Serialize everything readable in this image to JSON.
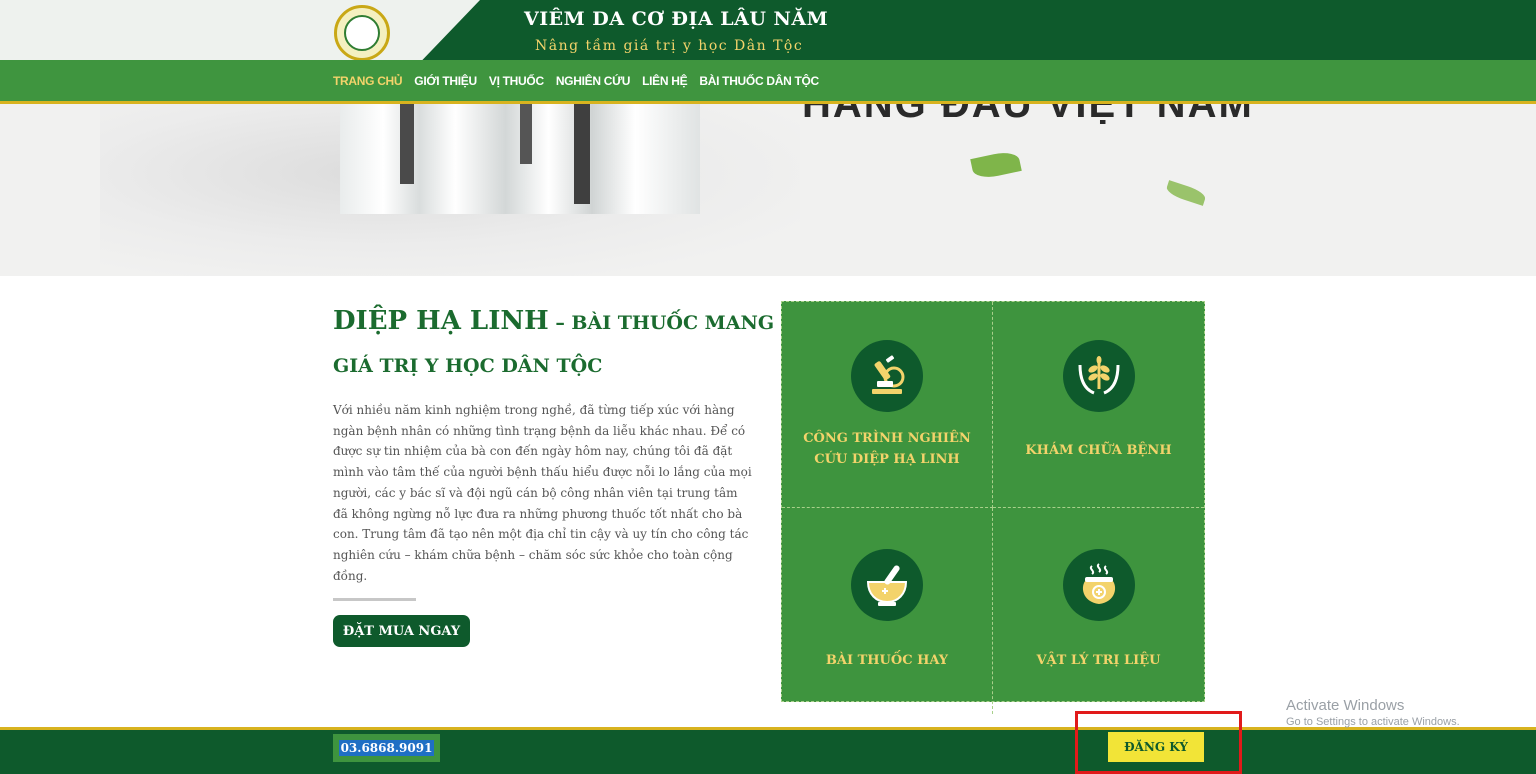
{
  "header": {
    "title": "VIÊM DA CƠ ĐỊA LÂU NĂM",
    "subtitle": "Nâng tầm giá trị y học Dân Tộc",
    "logo": "logo-icon"
  },
  "nav": {
    "items": [
      {
        "label": "TRANG CHỦ"
      },
      {
        "label": "GIỚI THIỆU"
      },
      {
        "label": "VỊ THUỐC"
      },
      {
        "label": "NGHIÊN CỨU"
      },
      {
        "label": "LIÊN HỆ"
      },
      {
        "label": "BÀI THUỐC DÂN TỘC"
      }
    ]
  },
  "hero": {
    "text": "HÀNG ĐẦU VIỆT NAM"
  },
  "intro": {
    "title_main": "DIỆP HẠ LINH",
    "title_rest": " – BÀI THUỐC MANG",
    "title_line2": "GIÁ TRỊ Y HỌC DÂN TỘC",
    "paragraph": "Với nhiều năm kinh nghiệm trong nghề, đã từng tiếp xúc với hàng ngàn bệnh nhân có những tình trạng bệnh da liễu khác nhau. Để có được sự tin nhiệm của bà con đến ngày hôm nay, chúng tôi đã đặt mình vào tâm thế của người bệnh thấu hiểu được nỗi lo lắng của mọi người, các y bác sĩ và đội ngũ cán bộ công nhân viên tại trung tâm đã không ngừng nỗ lực đưa ra những phương thuốc tốt nhất cho bà con. Trung tâm đã tạo nên một địa chỉ tin cậy và uy tín cho công tác nghiên cứu – khám chữa bệnh – chăm sóc sức khỏe cho toàn cộng đồng.",
    "button": "ĐẶT MUA NGAY"
  },
  "features": [
    {
      "label": "CÔNG TRÌNH NGHIÊN CỨU DIỆP HẠ LINH",
      "icon": "microscope-icon"
    },
    {
      "label": "KHÁM CHỮA BỆNH",
      "icon": "hands-plant-icon"
    },
    {
      "label": "BÀI THUỐC HAY",
      "icon": "mortar-pestle-icon"
    },
    {
      "label": "VẬT LÝ TRỊ LIỆU",
      "icon": "steam-jar-icon"
    }
  ],
  "footer": {
    "phone": "03.6868.9091",
    "register": "ĐĂNG KÝ"
  },
  "watermark": {
    "line1": "Activate Windows",
    "line2": "Go to Settings to activate Windows."
  },
  "colors": {
    "dark_green": "#0e5a2c",
    "green": "#3e943e",
    "gold": "#f3d36b",
    "yellow_button": "#f2e437",
    "highlight": "#e11a1a"
  }
}
